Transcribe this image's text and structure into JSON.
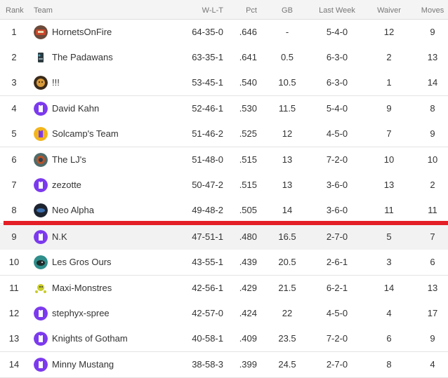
{
  "headers": {
    "rank": "Rank",
    "team": "Team",
    "wlt": "W-L-T",
    "pct": "Pct",
    "gb": "GB",
    "last_week": "Last Week",
    "waiver": "Waiver",
    "moves": "Moves"
  },
  "colors": {
    "cutoff_line": "#e41e26",
    "avatar_purple": "#7c3aed"
  },
  "rows": [
    {
      "rank": "1",
      "team": "HornetsOnFire",
      "wlt": "64-35-0",
      "pct": ".646",
      "gb": "-",
      "last_week": "5-4-0",
      "waiver": "12",
      "moves": "9",
      "icon": "hornet-avatar-icon"
    },
    {
      "rank": "2",
      "team": "The Padawans",
      "wlt": "63-35-1",
      "pct": ".641",
      "gb": "0.5",
      "last_week": "6-3-0",
      "waiver": "2",
      "moves": "13",
      "icon": "robot-avatar-icon"
    },
    {
      "rank": "3",
      "team": "!!!",
      "wlt": "53-45-1",
      "pct": ".540",
      "gb": "10.5",
      "last_week": "6-3-0",
      "waiver": "1",
      "moves": "14",
      "icon": "face-avatar-icon"
    },
    {
      "rank": "4",
      "team": "David Kahn",
      "wlt": "52-46-1",
      "pct": ".530",
      "gb": "11.5",
      "last_week": "5-4-0",
      "waiver": "9",
      "moves": "8",
      "icon": "jersey-avatar-icon"
    },
    {
      "rank": "5",
      "team": "Solcamp's Team",
      "wlt": "51-46-2",
      "pct": ".525",
      "gb": "12",
      "last_week": "4-5-0",
      "waiver": "7",
      "moves": "9",
      "icon": "jersey-yellow-avatar-icon"
    },
    {
      "rank": "6",
      "team": "The LJ's",
      "wlt": "51-48-0",
      "pct": ".515",
      "gb": "13",
      "last_week": "7-2-0",
      "waiver": "10",
      "moves": "10",
      "icon": "logo-avatar-icon"
    },
    {
      "rank": "7",
      "team": "zezotte",
      "wlt": "50-47-2",
      "pct": ".515",
      "gb": "13",
      "last_week": "3-6-0",
      "waiver": "13",
      "moves": "2",
      "icon": "jersey-avatar-icon"
    },
    {
      "rank": "8",
      "team": "Neo Alpha",
      "wlt": "49-48-2",
      "pct": ".505",
      "gb": "14",
      "last_week": "3-6-0",
      "waiver": "11",
      "moves": "11",
      "icon": "dark-logo-avatar-icon"
    },
    {
      "rank": "9",
      "team": "N.K",
      "wlt": "47-51-1",
      "pct": ".480",
      "gb": "16.5",
      "last_week": "2-7-0",
      "waiver": "5",
      "moves": "7",
      "icon": "jersey-avatar-icon"
    },
    {
      "rank": "10",
      "team": "Les Gros Ours",
      "wlt": "43-55-1",
      "pct": ".439",
      "gb": "20.5",
      "last_week": "2-6-1",
      "waiver": "3",
      "moves": "6",
      "icon": "bear-avatar-icon"
    },
    {
      "rank": "11",
      "team": "Maxi-Monstres",
      "wlt": "42-56-1",
      "pct": ".429",
      "gb": "21.5",
      "last_week": "6-2-1",
      "waiver": "14",
      "moves": "13",
      "icon": "monster-avatar-icon"
    },
    {
      "rank": "12",
      "team": "stephyx-spree",
      "wlt": "42-57-0",
      "pct": ".424",
      "gb": "22",
      "last_week": "4-5-0",
      "waiver": "4",
      "moves": "17",
      "icon": "jersey-avatar-icon"
    },
    {
      "rank": "13",
      "team": "Knights of Gotham",
      "wlt": "40-58-1",
      "pct": ".409",
      "gb": "23.5",
      "last_week": "7-2-0",
      "waiver": "6",
      "moves": "9",
      "icon": "jersey-avatar-icon"
    },
    {
      "rank": "14",
      "team": "Minny Mustang",
      "wlt": "38-58-3",
      "pct": ".399",
      "gb": "24.5",
      "last_week": "2-7-0",
      "waiver": "8",
      "moves": "4",
      "icon": "jersey-avatar-icon"
    }
  ]
}
